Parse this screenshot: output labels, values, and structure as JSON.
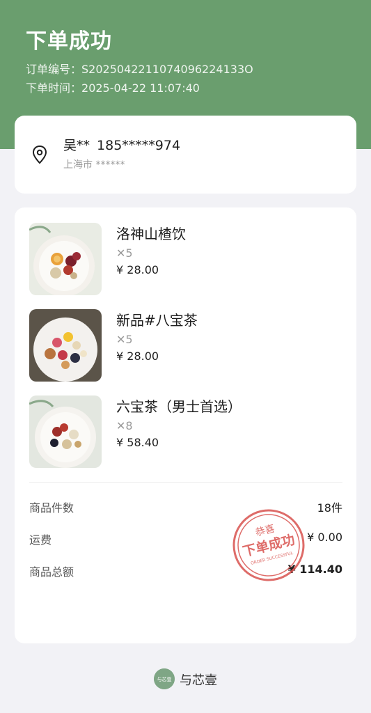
{
  "header": {
    "title": "下单成功",
    "order_no_label": "订单编号：",
    "order_no": "S2025042211074096224133O",
    "order_time_label": "下单时间：",
    "order_time": "2025-04-22 11:07:40"
  },
  "address": {
    "name": "吴**",
    "phone": "185*****974",
    "city": "上海市 ******"
  },
  "items": [
    {
      "name": "洛神山楂饮",
      "qty": "✕5",
      "price": "¥ 28.00"
    },
    {
      "name": "新品#八宝茶",
      "qty": "✕5",
      "price": "¥ 28.00"
    },
    {
      "name": "六宝茶（男士首选）",
      "qty": "✕8",
      "price": "¥ 58.40"
    }
  ],
  "summary": {
    "count_label": "商品件数",
    "count_value": "18件",
    "shipping_label": "运费",
    "shipping_value": "¥ 0.00",
    "total_label": "商品总额",
    "total_value": "¥ 114.40"
  },
  "stamp": {
    "top_text": "恭喜",
    "main_text": "下单成功",
    "sub_text": "ORDER SUCCESSFUL",
    "color": "#d9534f"
  },
  "footer": {
    "logo_text": "与芯壹",
    "brand": "与芯壹"
  },
  "colors": {
    "header_bg": "#6a9e6e",
    "page_bg": "#f2f2f6"
  }
}
